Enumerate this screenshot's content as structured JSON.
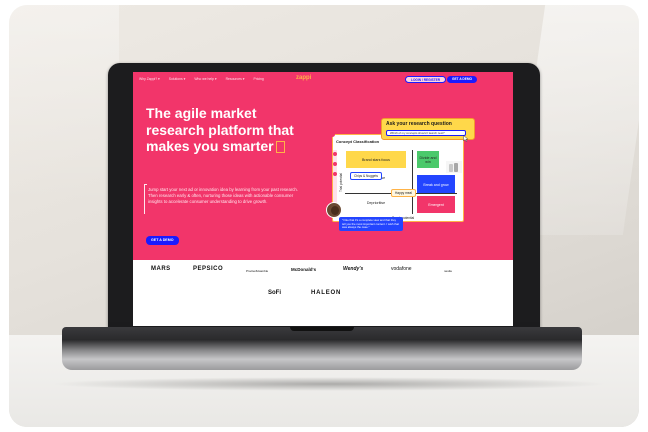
{
  "nav": {
    "items": [
      "Why Zappi? ▾",
      "Solutions ▾",
      "Who we help ▾",
      "Resources ▾",
      "Pricing"
    ],
    "logo": "zappi",
    "login_label": "LOGIN / REGISTER",
    "demo_label": "GET A DEMO"
  },
  "hero": {
    "title": "The agile market research platform that makes you smarter",
    "cursor": "L",
    "description": "Jump start your next ad or innovation idea by learning from your past research. Then research early & often, nurturing those ideas with actionable consumer insights to accelerate consumer understanding to drive growth.",
    "cta_label": "GET A DEMO"
  },
  "ask": {
    "title": "Ask your research question",
    "input": "Which of my concepts should I launch next?"
  },
  "concept_card": {
    "title": "Concept Classification",
    "y_axis": "Trial potential",
    "x_axis": "Reach potential",
    "cells": {
      "top_left": "Brand stars focus",
      "top_right": "Divide and win",
      "mid_left": "Deprioritise",
      "mid_right": "Break and grow",
      "bottom_left": "Deprioritise",
      "bottom_right": "Emergent"
    },
    "chips": {
      "chips_nuggets": "Chips & Nuggets",
      "happy_meal": "Happy meal"
    }
  },
  "quote": {
    "text": "\"I like that it's a complete view and that they tell you the most important content. I wish that was always the case.\""
  },
  "logos": [
    "MARS",
    "PEPSICO",
    "Procter&Gamble",
    "McDonald's",
    "Wendy's",
    "vodafone",
    "nestle",
    "SoFi",
    "HALEON"
  ],
  "colors": {
    "brand_pink": "#f2356a",
    "brand_blue": "#1a1aff",
    "brand_yellow": "#ffd84a",
    "brand_green": "#4bc96b"
  }
}
